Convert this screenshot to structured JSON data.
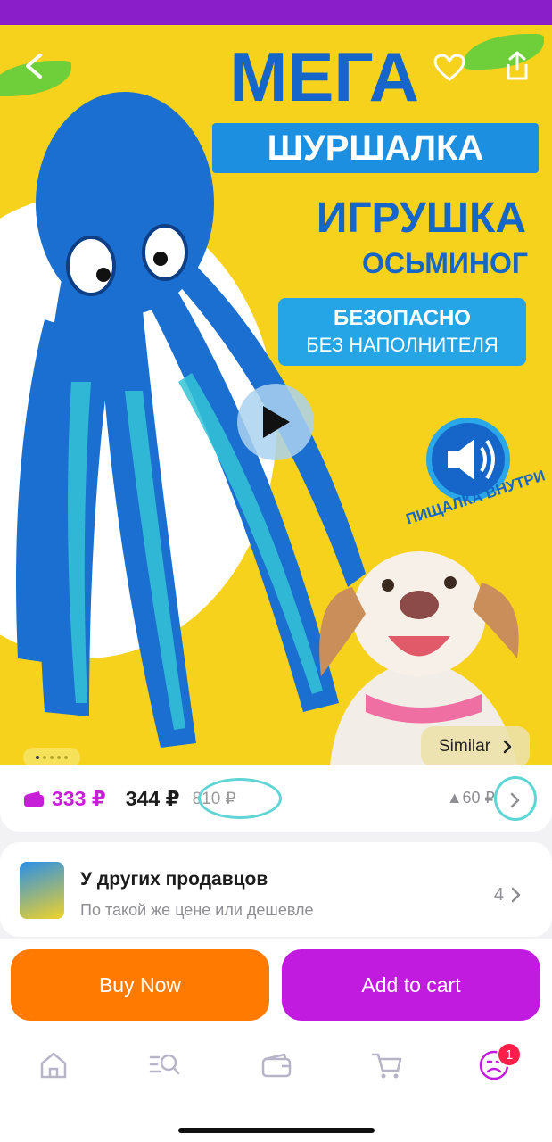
{
  "hero": {
    "promo_line1": "МЕГА",
    "promo_line2": "ШУРШАЛКА",
    "promo_line3": "ИГРУШКА",
    "promo_line4": "ОСЬМИНОГ",
    "safe_line1": "БЕЗОПАСНО",
    "safe_line2": "БЕЗ НАПОЛНИТЕЛЯ",
    "squeak_label": "ПИЩАЛКА ВНУТРИ",
    "similar_label": "Similar",
    "gallery_current": 1,
    "gallery_total": 5
  },
  "price": {
    "wallet_price": "333 ₽",
    "current_price": "344 ₽",
    "old_price": "810 ₽",
    "drop": "▲60 ₽"
  },
  "sellers": {
    "title": "У других продавцов",
    "subtitle": "По такой же цене или дешевле",
    "count": "4"
  },
  "actions": {
    "buy_now": "Buy Now",
    "add_to_cart": "Add to cart"
  },
  "tabbar": {
    "profile_badge": "1"
  },
  "colors": {
    "accent_purple": "#c21be0",
    "accent_orange": "#ff7a00",
    "hero_yellow": "#f7d21c"
  }
}
